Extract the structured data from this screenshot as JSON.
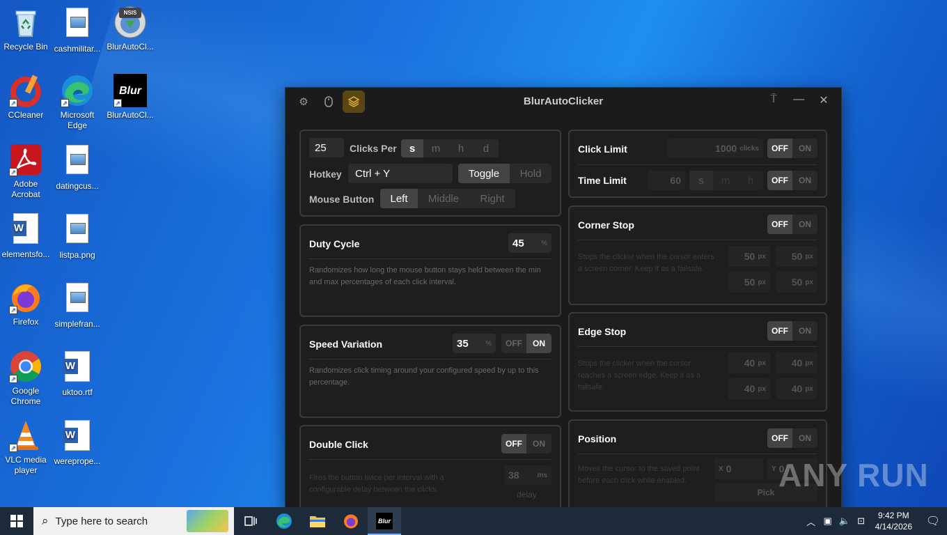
{
  "desktop": {
    "icons": [
      {
        "label": "Recycle Bin"
      },
      {
        "label": "cashmilitar..."
      },
      {
        "label": "BlurAutoCl..."
      },
      {
        "label": "CCleaner"
      },
      {
        "label": "Microsoft Edge"
      },
      {
        "label": "BlurAutoCl..."
      },
      {
        "label": "Adobe Acrobat"
      },
      {
        "label": "datingcus..."
      },
      {
        "label": "elementsfo..."
      },
      {
        "label": "listpa.png"
      },
      {
        "label": "Firefox"
      },
      {
        "label": "simplefran..."
      },
      {
        "label": "Google Chrome"
      },
      {
        "label": "uktoo.rtf"
      },
      {
        "label": "VLC media player"
      },
      {
        "label": "wereprope..."
      }
    ],
    "blur_logo_text": "Blur",
    "nsis_text": "NSIS"
  },
  "app": {
    "title": "BlurAutoClicker",
    "accent": "#e3b23c",
    "clicks": {
      "count": "25",
      "clicks_per_label": "Clicks Per",
      "units": [
        "s",
        "m",
        "h",
        "d"
      ],
      "selected_unit": "s",
      "hotkey_label": "Hotkey",
      "hotkey_value": "Ctrl + Y",
      "mode_options": [
        "Toggle",
        "Hold"
      ],
      "selected_mode": "Toggle",
      "mouse_button_label": "Mouse Button",
      "mouse_buttons": [
        "Left",
        "Middle",
        "Right"
      ],
      "selected_button": "Left"
    },
    "duty_cycle": {
      "label": "Duty Cycle",
      "value": "45",
      "unit": "%",
      "description": "Randomizes how long the mouse button stays held between the min and max percentages of each click interval."
    },
    "speed_variation": {
      "label": "Speed Variation",
      "value": "35",
      "unit": "%",
      "off": "OFF",
      "on": "ON",
      "state": "ON",
      "description": "Randomizes click timing around your configured speed by up to this percentage."
    },
    "double_click": {
      "label": "Double Click",
      "off": "OFF",
      "on": "ON",
      "state": "OFF",
      "description": "Fires the button twice per interval with a configurable delay between the clicks.",
      "delay_value": "38",
      "delay_unit": "ms",
      "delay_label": "delay"
    },
    "click_limit": {
      "label": "Click Limit",
      "value": "1000",
      "unit": "clicks",
      "off": "OFF",
      "on": "ON",
      "state": "OFF"
    },
    "time_limit": {
      "label": "Time Limit",
      "value": "60",
      "units": [
        "s",
        "m",
        "h"
      ],
      "off": "OFF",
      "on": "ON",
      "state": "OFF"
    },
    "corner_stop": {
      "label": "Corner Stop",
      "off": "OFF",
      "on": "ON",
      "state": "OFF",
      "description": "Stops the clicker when the cursor enters a screen corner. Keep it as a failsafe.",
      "values": [
        "50",
        "50",
        "50",
        "50"
      ],
      "unit": "px"
    },
    "edge_stop": {
      "label": "Edge Stop",
      "off": "OFF",
      "on": "ON",
      "state": "OFF",
      "description": "Stops the clicker when the cursor reaches a screen edge. Keep it as a failsafe.",
      "values": [
        "40",
        "40",
        "40",
        "40"
      ],
      "unit": "px"
    },
    "position": {
      "label": "Position",
      "off": "OFF",
      "on": "ON",
      "state": "OFF",
      "description": "Moves the cursor to the saved point before each click while enabled.",
      "x_label": "X",
      "x_value": "0",
      "y_label": "Y",
      "y_value": "0",
      "pick_label": "Pick"
    }
  },
  "taskbar": {
    "search_placeholder": "Type here to search",
    "active_app_label": "Blur",
    "time": "9:42 PM",
    "date": "4/14/2026"
  },
  "watermark": "ANY RUN"
}
